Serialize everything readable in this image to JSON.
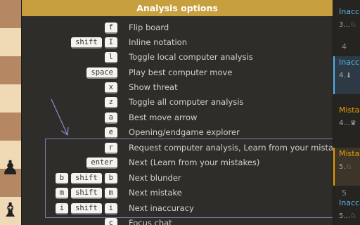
{
  "modal": {
    "title": "Analysis options",
    "shortcuts": [
      {
        "keys": [
          "f"
        ],
        "label": "Flip board"
      },
      {
        "keys": [
          "shift",
          "I"
        ],
        "label": "Inline notation"
      },
      {
        "keys": [
          "l"
        ],
        "label": "Toggle local computer analysis"
      },
      {
        "keys": [
          "space"
        ],
        "label": "Play best computer move"
      },
      {
        "keys": [
          "x"
        ],
        "label": "Show threat"
      },
      {
        "keys": [
          "z"
        ],
        "label": "Toggle all computer analysis"
      },
      {
        "keys": [
          "a"
        ],
        "label": "Best move arrow"
      },
      {
        "keys": [
          "e"
        ],
        "label": "Opening/endgame explorer"
      },
      {
        "keys": [
          "r"
        ],
        "label": "Request computer analysis, Learn from your mistakes"
      },
      {
        "keys": [
          "enter"
        ],
        "label": "Next (Learn from your mistakes)"
      },
      {
        "keys": [
          "b",
          "shift",
          "b"
        ],
        "label": "Next blunder"
      },
      {
        "keys": [
          "m",
          "shift",
          "m"
        ],
        "label": "Next mistake"
      },
      {
        "keys": [
          "i",
          "shift",
          "i"
        ],
        "label": "Next inaccuracy"
      },
      {
        "keys": [
          "c"
        ],
        "label": "Focus chat"
      }
    ]
  },
  "move_list": [
    {
      "label": "Inacc",
      "sub": "3...♘"
    },
    {
      "label": "4",
      "sub": ""
    },
    {
      "label": "Inacc",
      "sub": "4.♝"
    },
    {
      "label": "Mista",
      "sub": "4...♛"
    },
    {
      "label": "Mista",
      "sub": "5.♘"
    },
    {
      "label": "5",
      "sub": ""
    },
    {
      "label": "Inacc",
      "sub": "5...♘"
    }
  ],
  "colors": {
    "header": "#c89f3f",
    "highlight_border": "#7b7bb3",
    "inaccuracy": "#56b4e9",
    "mistake": "#e69f00"
  }
}
